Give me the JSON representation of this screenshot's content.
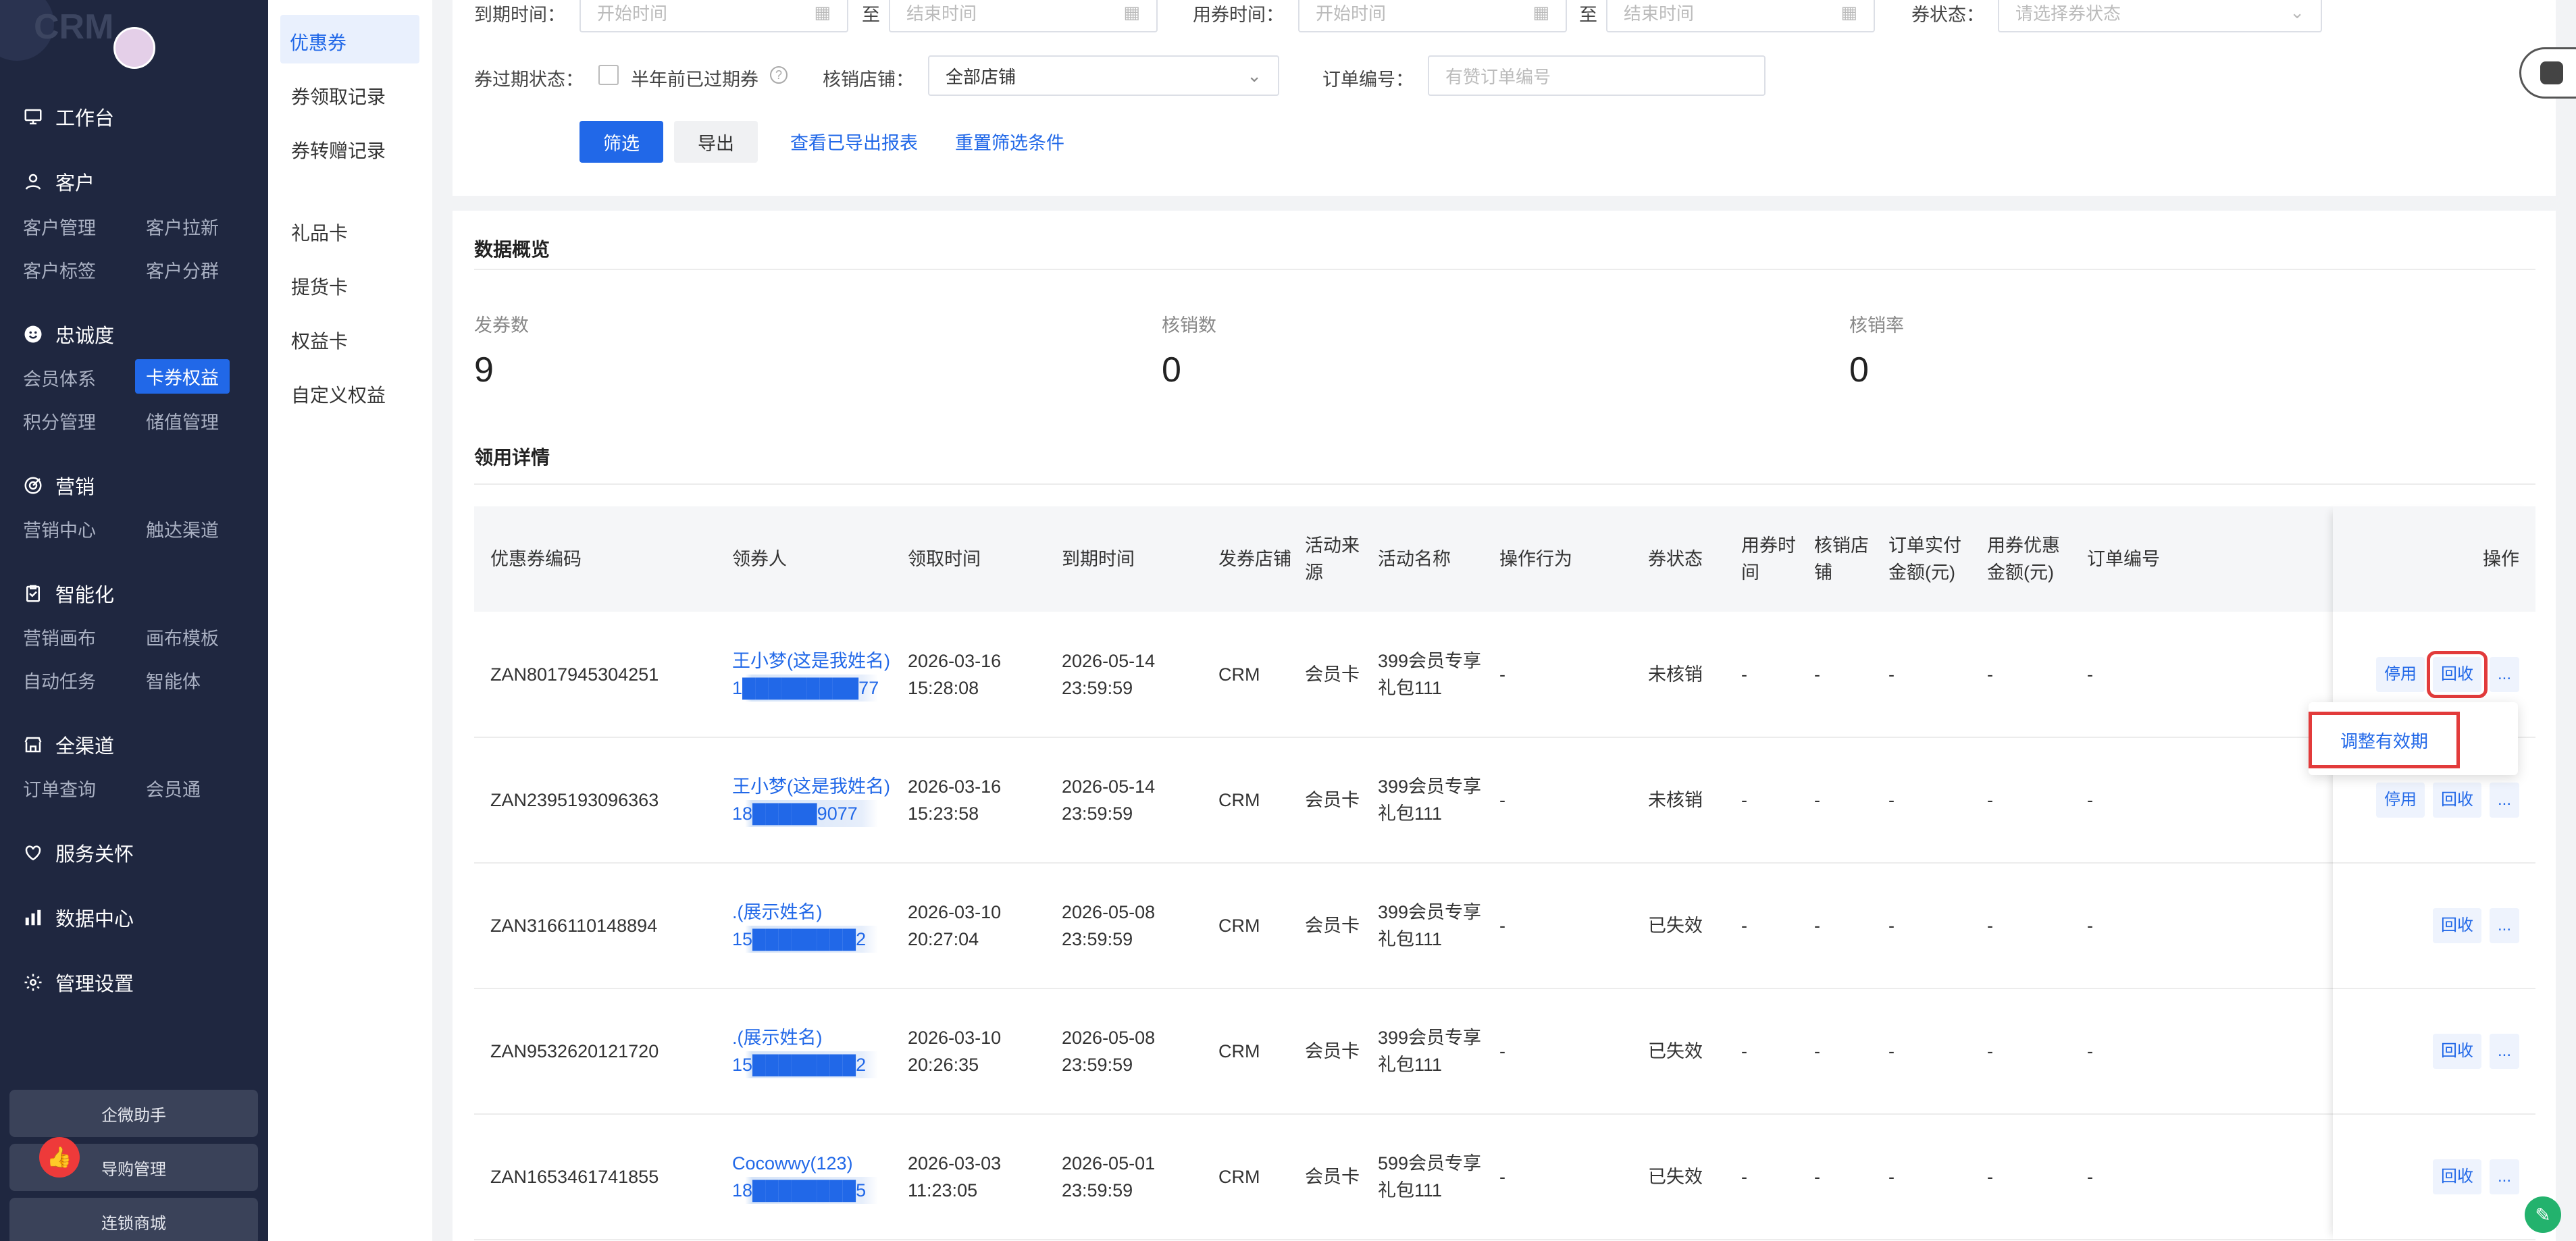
{
  "sidebar": {
    "logo": "CRM",
    "workbench": "工作台",
    "customer": {
      "title": "客户",
      "items": [
        "客户管理",
        "客户拉新",
        "客户标签",
        "客户分群"
      ]
    },
    "loyalty": {
      "title": "忠诚度",
      "items": [
        "会员体系",
        "卡券权益",
        "积分管理",
        "储值管理"
      ],
      "active": "卡券权益"
    },
    "marketing": {
      "title": "营销",
      "items": [
        "营销中心",
        "触达渠道"
      ]
    },
    "intelligence": {
      "title": "智能化",
      "items": [
        "营销画布",
        "画布模板",
        "自动任务",
        "智能体"
      ]
    },
    "omni": {
      "title": "全渠道",
      "items": [
        "订单查询",
        "会员通"
      ]
    },
    "service": "服务关怀",
    "data_center": "数据中心",
    "settings": "管理设置",
    "bottom": [
      "企微助手",
      "导购管理",
      "连锁商城"
    ]
  },
  "subnav": {
    "items": [
      "优惠券",
      "券领取记录",
      "券转赠记录",
      "礼品卡",
      "提货卡",
      "权益卡",
      "自定义权益"
    ],
    "active": "优惠券"
  },
  "filters": {
    "expire_time_label": "到期时间：",
    "start_ph": "开始时间",
    "to": "至",
    "end_ph": "结束时间",
    "use_time_label": "用券时间：",
    "status_label": "券状态：",
    "status_ph": "请选择券状态",
    "expired_status_label": "券过期状态：",
    "half_year_label": "半年前已过期券",
    "verify_store_label": "核销店铺：",
    "verify_store_value": "全部店铺",
    "order_no_label": "订单编号：",
    "order_no_ph": "有赞订单编号",
    "filter_btn": "筛选",
    "export_btn": "导出",
    "view_export": "查看已导出报表",
    "reset": "重置筛选条件"
  },
  "overview": {
    "title": "数据概览",
    "stats": [
      {
        "label": "发券数",
        "value": "9"
      },
      {
        "label": "核销数",
        "value": "0"
      },
      {
        "label": "核销率",
        "value": "0"
      }
    ]
  },
  "detail": {
    "title": "领用详情",
    "columns": [
      "优惠券编码",
      "领券人",
      "领取时间",
      "到期时间",
      "发券店铺",
      "活动来源",
      "活动名称",
      "操作行为",
      "券状态",
      "用券时间",
      "核销店铺",
      "订单实付金额(元)",
      "用券优惠金额(元)",
      "订单编号",
      "操作"
    ],
    "rows": [
      {
        "code": "ZAN8017945304251",
        "name": "王小梦(这是我姓名)",
        "phone": "1█████████77",
        "get": "2026-03-16 15:28:08",
        "exp": "2026-05-14 23:59:59",
        "shop": "CRM",
        "src": "会员卡",
        "act": "399会员专享礼包111",
        "op": "-",
        "status": "未核销",
        "use": "-",
        "vshop": "-",
        "paid": "-",
        "disc": "-",
        "order": "-",
        "actions": [
          "停用",
          "回收",
          "..."
        ]
      },
      {
        "code": "ZAN2395193096363",
        "name": "王小梦(这是我姓名)",
        "phone": "18█████9077",
        "get": "2026-03-16 15:23:58",
        "exp": "2026-05-14 23:59:59",
        "shop": "CRM",
        "src": "会员卡",
        "act": "399会员专享礼包111",
        "op": "-",
        "status": "未核销",
        "use": "-",
        "vshop": "-",
        "paid": "-",
        "disc": "-",
        "order": "-",
        "actions": [
          "停用",
          "回收",
          "..."
        ]
      },
      {
        "code": "ZAN3166110148894",
        "name": ".(展示姓名)",
        "phone": "15████████2",
        "get": "2026-03-10 20:27:04",
        "exp": "2026-05-08 23:59:59",
        "shop": "CRM",
        "src": "会员卡",
        "act": "399会员专享礼包111",
        "op": "-",
        "status": "已失效",
        "use": "-",
        "vshop": "-",
        "paid": "-",
        "disc": "-",
        "order": "-",
        "actions": [
          "回收",
          "..."
        ]
      },
      {
        "code": "ZAN9532620121720",
        "name": ".(展示姓名)",
        "phone": "15████████2",
        "get": "2026-03-10 20:26:35",
        "exp": "2026-05-08 23:59:59",
        "shop": "CRM",
        "src": "会员卡",
        "act": "399会员专享礼包111",
        "op": "-",
        "status": "已失效",
        "use": "-",
        "vshop": "-",
        "paid": "-",
        "disc": "-",
        "order": "-",
        "actions": [
          "回收",
          "..."
        ]
      },
      {
        "code": "ZAN1653461741855",
        "name": "Cocowwy(123)",
        "phone": "18████████5",
        "get": "2026-03-03 11:23:05",
        "exp": "2026-05-01 23:59:59",
        "shop": "CRM",
        "src": "会员卡",
        "act": "599会员专享礼包111",
        "op": "-",
        "status": "已失效",
        "use": "-",
        "vshop": "-",
        "paid": "-",
        "disc": "-",
        "order": "-",
        "actions": [
          "回收",
          "..."
        ]
      }
    ]
  },
  "popup": {
    "label": "调整有效期"
  }
}
